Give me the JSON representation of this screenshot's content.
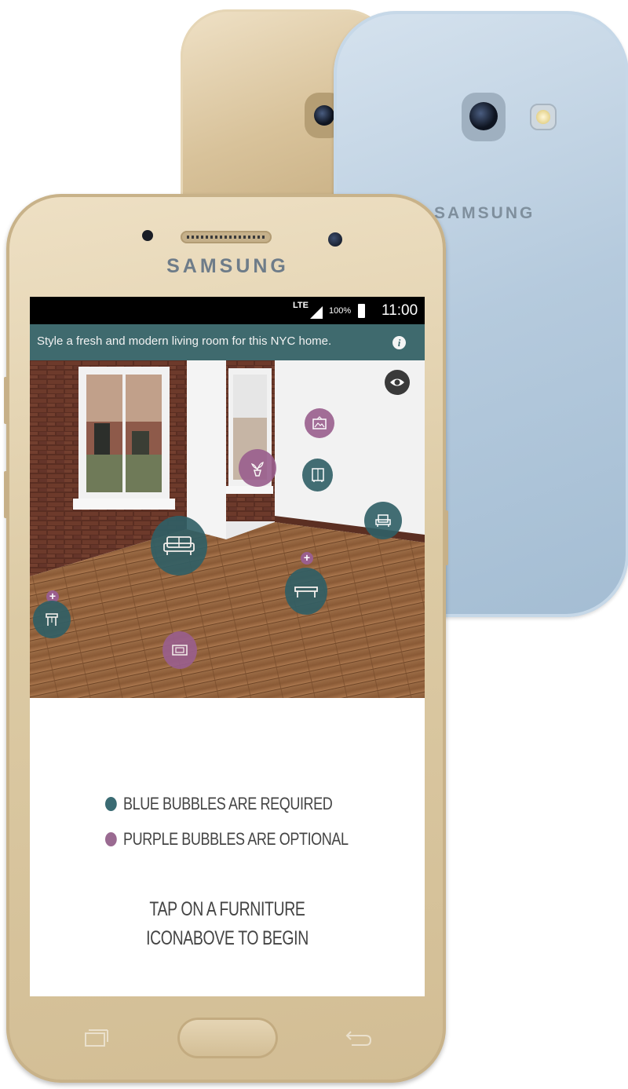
{
  "back_phone": {
    "brand": "SAMSUNG"
  },
  "front_phone": {
    "brand": "SAMSUNG"
  },
  "status_bar": {
    "network": "LTE",
    "battery": "100%",
    "time": "11:00"
  },
  "banner": {
    "text": "Style a fresh and modern living room for this NYC home.",
    "info_icon": "info-icon"
  },
  "room_view": {
    "toggle_icon": "eye-icon",
    "bubbles": [
      {
        "item": "wall-art",
        "type": "optional",
        "icon": "picture-icon"
      },
      {
        "item": "plant",
        "type": "optional",
        "icon": "plant-icon"
      },
      {
        "item": "cabinet",
        "type": "required",
        "icon": "cabinet-icon"
      },
      {
        "item": "armchair",
        "type": "required",
        "icon": "armchair-icon"
      },
      {
        "item": "sofa",
        "type": "required",
        "icon": "sofa-icon"
      },
      {
        "item": "coffee-table",
        "type": "required",
        "icon": "table-icon",
        "addable": true
      },
      {
        "item": "side-table",
        "type": "required",
        "icon": "side-table-icon",
        "addable": true
      },
      {
        "item": "rug",
        "type": "optional",
        "icon": "rug-icon"
      }
    ]
  },
  "legend": {
    "required": "BLUE BUBBLES ARE REQUIRED",
    "optional": "PURPLE BUBBLES ARE OPTIONAL",
    "required_color": "#3a6b73",
    "optional_color": "#9a6a91"
  },
  "cta": {
    "line1": "TAP ON A FURNITURE",
    "line2": "ICONABOVE TO BEGIN"
  },
  "colors": {
    "blue_bubble": "#2f5f66",
    "purple_bubble": "#9a5f8e",
    "banner": "#3f6a6e"
  }
}
